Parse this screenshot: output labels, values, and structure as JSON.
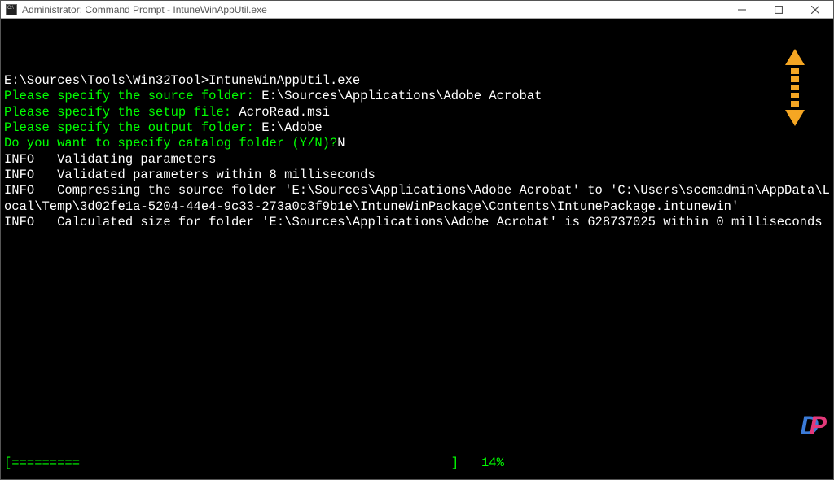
{
  "window": {
    "title": "Administrator: Command Prompt - IntuneWinAppUtil.exe"
  },
  "terminal": {
    "prompt_path": "E:\\Sources\\Tools\\Win32Tool>",
    "prompt_command": "IntuneWinAppUtil.exe",
    "q1_label": "Please specify the source folder: ",
    "q1_value": "E:\\Sources\\Applications\\Adobe Acrobat",
    "q2_label": "Please specify the setup file: ",
    "q2_value": "AcroRead.msi",
    "q3_label": "Please specify the output folder: ",
    "q3_value": "E:\\Adobe",
    "q4_label": "Do you want to specify catalog folder (Y/N)?",
    "q4_value": "N",
    "info1": "INFO   Validating parameters",
    "info2": "INFO   Validated parameters within 8 milliseconds",
    "info3": "INFO   Compressing the source folder 'E:\\Sources\\Applications\\Adobe Acrobat' to 'C:\\Users\\sccmadmin\\AppData\\Local\\Temp\\3d02fe1a-5204-44e4-9c33-273a0c3f9b1e\\IntuneWinPackage\\Contents\\IntunePackage.intunewin'",
    "info4": "INFO   Calculated size for folder 'E:\\Sources\\Applications\\Adobe Acrobat' is 628737025 within 0 milliseconds",
    "progress_bar": "[=========                                                 ]   14%"
  },
  "watermark": {
    "letter1": "D",
    "letter2": "P"
  }
}
